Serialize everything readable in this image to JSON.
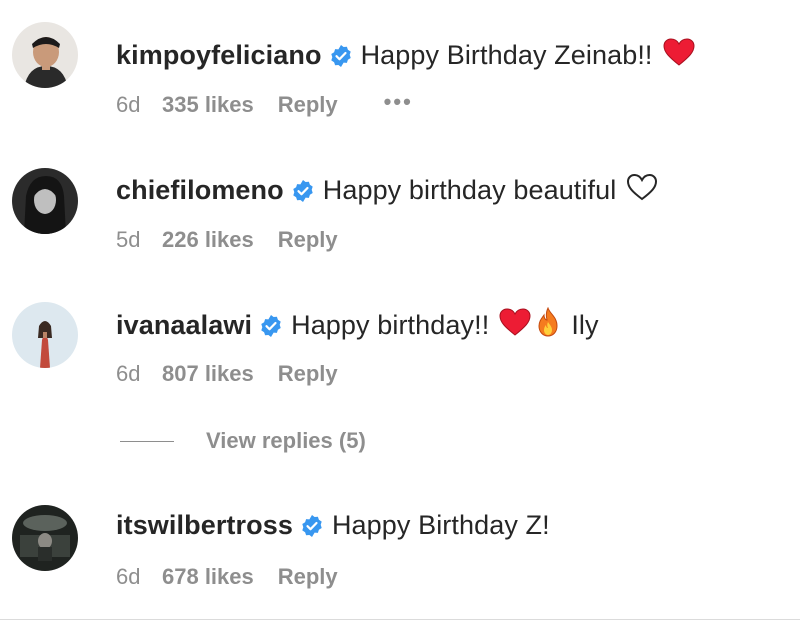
{
  "comments": [
    {
      "username": "kimpoyfeliciano",
      "text": "Happy Birthday Zeinab!!",
      "emoji": [
        "red-heart"
      ],
      "time": "6d",
      "likes": "335 likes",
      "reply": "Reply",
      "more": "•••"
    },
    {
      "username": "chiefilomeno",
      "text": "Happy birthday beautiful",
      "emoji": [
        "white-heart-outline"
      ],
      "time": "5d",
      "likes": "226 likes",
      "reply": "Reply"
    },
    {
      "username": "ivanaalawi",
      "text": "Happy birthday!!",
      "emoji": [
        "red-heart",
        "fire"
      ],
      "text_after": "Ily",
      "time": "6d",
      "likes": "807 likes",
      "reply": "Reply"
    },
    {
      "username": "itswilbertross",
      "text": "Happy Birthday Z!",
      "time": "6d",
      "likes": "678 likes",
      "reply": "Reply"
    }
  ],
  "view_replies": "View replies (5)",
  "colors": {
    "text": "#262626",
    "secondary": "#8e8e8e",
    "verified": "#3897f0",
    "heart": "#ed1c34"
  }
}
